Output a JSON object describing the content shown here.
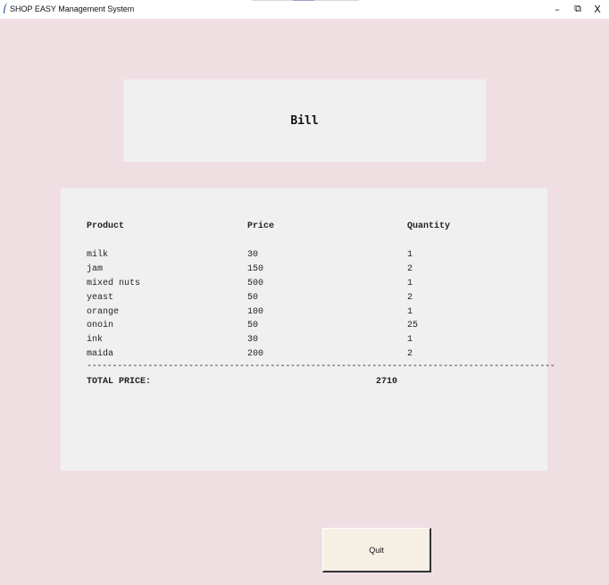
{
  "window": {
    "title": "SHOP EASY Management System",
    "minimize_glyph": "–",
    "restore_glyph": "⧉",
    "close_glyph": "X",
    "app_icon": "feather-icon"
  },
  "heading": {
    "text": "Bill"
  },
  "bill": {
    "headers": {
      "product": "Product",
      "price": "Price",
      "quantity": "Quantity"
    },
    "rows": [
      {
        "product": "milk",
        "price": "30",
        "quantity": "1"
      },
      {
        "product": "jam",
        "price": "150",
        "quantity": "2"
      },
      {
        "product": "mixed nuts",
        "price": "500",
        "quantity": "1"
      },
      {
        "product": "yeast",
        "price": "50",
        "quantity": "2"
      },
      {
        "product": "orange",
        "price": "100",
        "quantity": "1"
      },
      {
        "product": "onoin",
        "price": "50",
        "quantity": "25"
      },
      {
        "product": "ink",
        "price": "30",
        "quantity": "1"
      },
      {
        "product": "maida",
        "price": "200",
        "quantity": "2"
      }
    ],
    "separator": "--------------------------------------------------------------------------------------------",
    "total_label": "TOTAL PRICE:",
    "total_value": "2710"
  },
  "actions": {
    "quit_label": "Quit"
  },
  "colors": {
    "background": "#efdfe3",
    "panel": "#f0f0f0",
    "button": "#f6efe4"
  }
}
